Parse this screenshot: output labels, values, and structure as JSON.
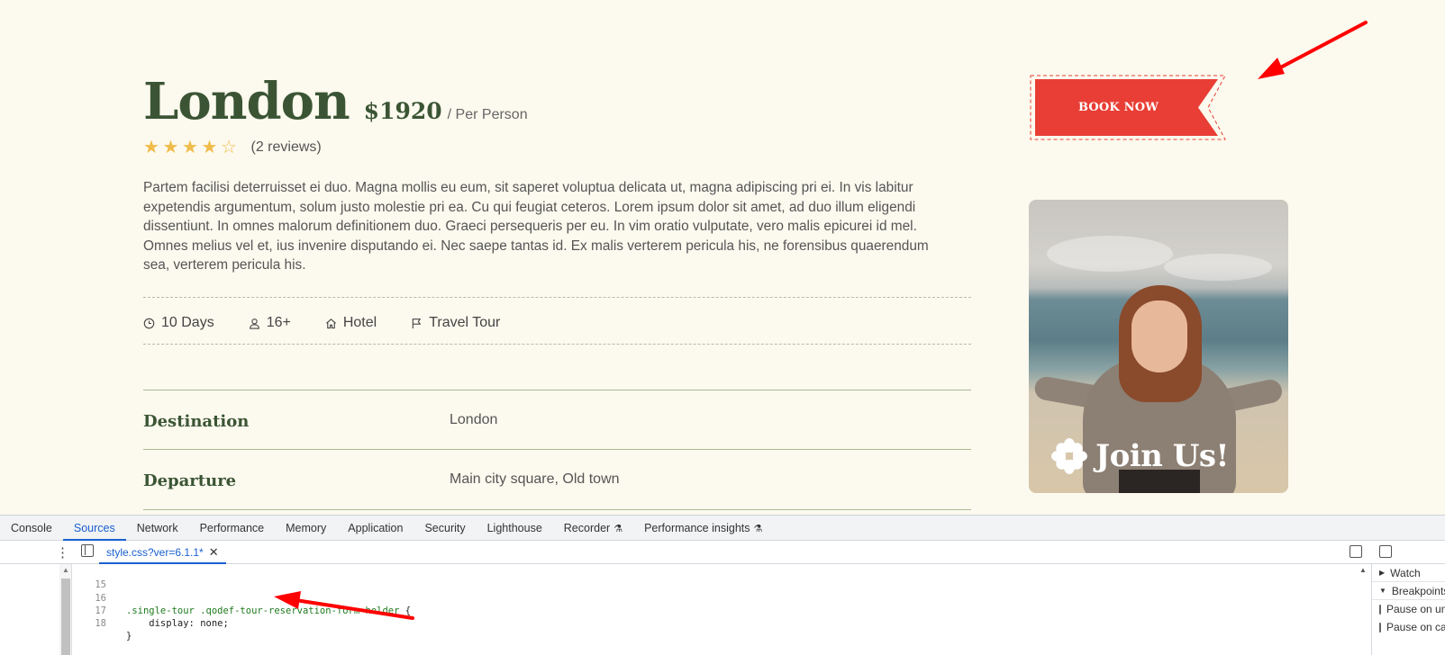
{
  "tour": {
    "title": "London",
    "price": "$1920",
    "price_unit": "/ Per Person",
    "rating": 4,
    "rating_max": 5,
    "reviews": "(2 reviews)",
    "description": "Partem facilisi deterruisset ei duo. Magna mollis eu eum, sit saperet voluptua delicata ut, magna adipiscing pri ei. In vis labitur expetendis argumentum, solum justo molestie pri ea. Cu qui feugiat ceteros. Lorem ipsum dolor sit amet, ad duo illum eligendi dissentiunt. In omnes malorum definitionem duo. Graeci persequeris per eu. In vim oratio vulputate, vero malis epicurei id mel. Omnes melius vel et, ius invenire disputando ei. Nec saepe tantas id. Ex malis verterem pericula his, ne forensibus quaerendum sea, verterem pericula his.",
    "meta": [
      {
        "icon": "clock-icon",
        "label": "10 Days"
      },
      {
        "icon": "user-icon",
        "label": "16+"
      },
      {
        "icon": "home-icon",
        "label": "Hotel"
      },
      {
        "icon": "flag-icon",
        "label": "Travel Tour"
      }
    ],
    "specs": [
      {
        "label": "Destination",
        "value": "London"
      },
      {
        "label": "Departure",
        "value": "Main city square, Old town"
      }
    ],
    "book_label": "BOOK NOW",
    "promo_text": "Join Us!"
  },
  "colors": {
    "page_bg": "#fcf9ee",
    "heading_green": "#3b5534",
    "star_gold": "#f0bc4a",
    "button_red": "#e83e35",
    "annotation_red": "#ff0000",
    "devtools_accent": "#1a5fd0"
  },
  "devtools": {
    "tabs": [
      {
        "label": "Console",
        "active": false
      },
      {
        "label": "Sources",
        "active": true
      },
      {
        "label": "Network",
        "active": false
      },
      {
        "label": "Performance",
        "active": false
      },
      {
        "label": "Memory",
        "active": false
      },
      {
        "label": "Application",
        "active": false
      },
      {
        "label": "Security",
        "active": false
      },
      {
        "label": "Lighthouse",
        "active": false
      },
      {
        "label": "Recorder",
        "active": false,
        "flask": true
      },
      {
        "label": "Performance insights",
        "active": false,
        "flask": true
      }
    ],
    "open_file": "style.css?ver=6.1.1*",
    "code_lines": [
      {
        "num": "15",
        "selector": "",
        "prop": "",
        "value": "",
        "raw": ""
      },
      {
        "num": "16",
        "selector": ".single-tour .qodef-tour-reservation-form-holder",
        "prop": "",
        "value": "",
        "raw": " {"
      },
      {
        "num": "17",
        "selector": "",
        "prop": "    display",
        "value": " none;",
        "raw": ":"
      },
      {
        "num": "18",
        "selector": "",
        "prop": "",
        "value": "",
        "raw": "}"
      }
    ],
    "side_panel": [
      {
        "label": "Watch",
        "type": "section",
        "expanded": false
      },
      {
        "label": "Breakpoints",
        "type": "section",
        "expanded": true
      },
      {
        "label": "Pause on uncaught exceptions",
        "type": "checkbox"
      },
      {
        "label": "Pause on caught exceptions",
        "type": "checkbox"
      }
    ]
  }
}
